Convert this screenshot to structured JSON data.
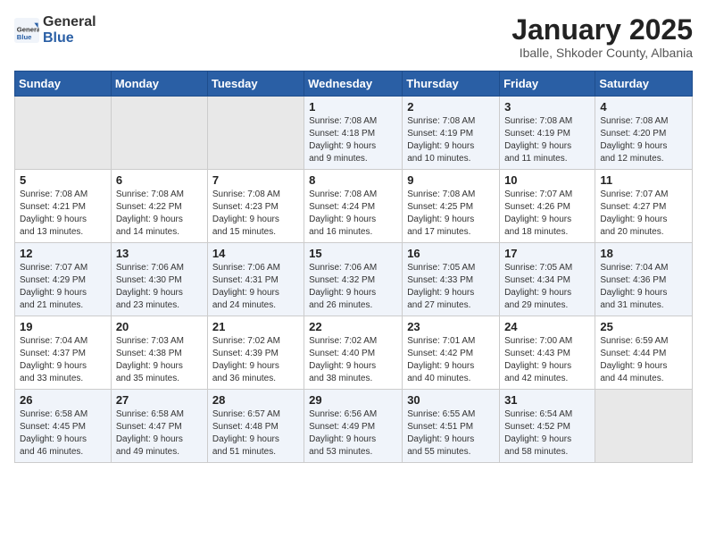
{
  "header": {
    "logo_general": "General",
    "logo_blue": "Blue",
    "main_title": "January 2025",
    "subtitle": "Iballe, Shkoder County, Albania"
  },
  "calendar": {
    "days_of_week": [
      "Sunday",
      "Monday",
      "Tuesday",
      "Wednesday",
      "Thursday",
      "Friday",
      "Saturday"
    ],
    "weeks": [
      [
        {
          "day": "",
          "content": ""
        },
        {
          "day": "",
          "content": ""
        },
        {
          "day": "",
          "content": ""
        },
        {
          "day": "1",
          "content": "Sunrise: 7:08 AM\nSunset: 4:18 PM\nDaylight: 9 hours\nand 9 minutes."
        },
        {
          "day": "2",
          "content": "Sunrise: 7:08 AM\nSunset: 4:19 PM\nDaylight: 9 hours\nand 10 minutes."
        },
        {
          "day": "3",
          "content": "Sunrise: 7:08 AM\nSunset: 4:19 PM\nDaylight: 9 hours\nand 11 minutes."
        },
        {
          "day": "4",
          "content": "Sunrise: 7:08 AM\nSunset: 4:20 PM\nDaylight: 9 hours\nand 12 minutes."
        }
      ],
      [
        {
          "day": "5",
          "content": "Sunrise: 7:08 AM\nSunset: 4:21 PM\nDaylight: 9 hours\nand 13 minutes."
        },
        {
          "day": "6",
          "content": "Sunrise: 7:08 AM\nSunset: 4:22 PM\nDaylight: 9 hours\nand 14 minutes."
        },
        {
          "day": "7",
          "content": "Sunrise: 7:08 AM\nSunset: 4:23 PM\nDaylight: 9 hours\nand 15 minutes."
        },
        {
          "day": "8",
          "content": "Sunrise: 7:08 AM\nSunset: 4:24 PM\nDaylight: 9 hours\nand 16 minutes."
        },
        {
          "day": "9",
          "content": "Sunrise: 7:08 AM\nSunset: 4:25 PM\nDaylight: 9 hours\nand 17 minutes."
        },
        {
          "day": "10",
          "content": "Sunrise: 7:07 AM\nSunset: 4:26 PM\nDaylight: 9 hours\nand 18 minutes."
        },
        {
          "day": "11",
          "content": "Sunrise: 7:07 AM\nSunset: 4:27 PM\nDaylight: 9 hours\nand 20 minutes."
        }
      ],
      [
        {
          "day": "12",
          "content": "Sunrise: 7:07 AM\nSunset: 4:29 PM\nDaylight: 9 hours\nand 21 minutes."
        },
        {
          "day": "13",
          "content": "Sunrise: 7:06 AM\nSunset: 4:30 PM\nDaylight: 9 hours\nand 23 minutes."
        },
        {
          "day": "14",
          "content": "Sunrise: 7:06 AM\nSunset: 4:31 PM\nDaylight: 9 hours\nand 24 minutes."
        },
        {
          "day": "15",
          "content": "Sunrise: 7:06 AM\nSunset: 4:32 PM\nDaylight: 9 hours\nand 26 minutes."
        },
        {
          "day": "16",
          "content": "Sunrise: 7:05 AM\nSunset: 4:33 PM\nDaylight: 9 hours\nand 27 minutes."
        },
        {
          "day": "17",
          "content": "Sunrise: 7:05 AM\nSunset: 4:34 PM\nDaylight: 9 hours\nand 29 minutes."
        },
        {
          "day": "18",
          "content": "Sunrise: 7:04 AM\nSunset: 4:36 PM\nDaylight: 9 hours\nand 31 minutes."
        }
      ],
      [
        {
          "day": "19",
          "content": "Sunrise: 7:04 AM\nSunset: 4:37 PM\nDaylight: 9 hours\nand 33 minutes."
        },
        {
          "day": "20",
          "content": "Sunrise: 7:03 AM\nSunset: 4:38 PM\nDaylight: 9 hours\nand 35 minutes."
        },
        {
          "day": "21",
          "content": "Sunrise: 7:02 AM\nSunset: 4:39 PM\nDaylight: 9 hours\nand 36 minutes."
        },
        {
          "day": "22",
          "content": "Sunrise: 7:02 AM\nSunset: 4:40 PM\nDaylight: 9 hours\nand 38 minutes."
        },
        {
          "day": "23",
          "content": "Sunrise: 7:01 AM\nSunset: 4:42 PM\nDaylight: 9 hours\nand 40 minutes."
        },
        {
          "day": "24",
          "content": "Sunrise: 7:00 AM\nSunset: 4:43 PM\nDaylight: 9 hours\nand 42 minutes."
        },
        {
          "day": "25",
          "content": "Sunrise: 6:59 AM\nSunset: 4:44 PM\nDaylight: 9 hours\nand 44 minutes."
        }
      ],
      [
        {
          "day": "26",
          "content": "Sunrise: 6:58 AM\nSunset: 4:45 PM\nDaylight: 9 hours\nand 46 minutes."
        },
        {
          "day": "27",
          "content": "Sunrise: 6:58 AM\nSunset: 4:47 PM\nDaylight: 9 hours\nand 49 minutes."
        },
        {
          "day": "28",
          "content": "Sunrise: 6:57 AM\nSunset: 4:48 PM\nDaylight: 9 hours\nand 51 minutes."
        },
        {
          "day": "29",
          "content": "Sunrise: 6:56 AM\nSunset: 4:49 PM\nDaylight: 9 hours\nand 53 minutes."
        },
        {
          "day": "30",
          "content": "Sunrise: 6:55 AM\nSunset: 4:51 PM\nDaylight: 9 hours\nand 55 minutes."
        },
        {
          "day": "31",
          "content": "Sunrise: 6:54 AM\nSunset: 4:52 PM\nDaylight: 9 hours\nand 58 minutes."
        },
        {
          "day": "",
          "content": ""
        }
      ]
    ]
  }
}
